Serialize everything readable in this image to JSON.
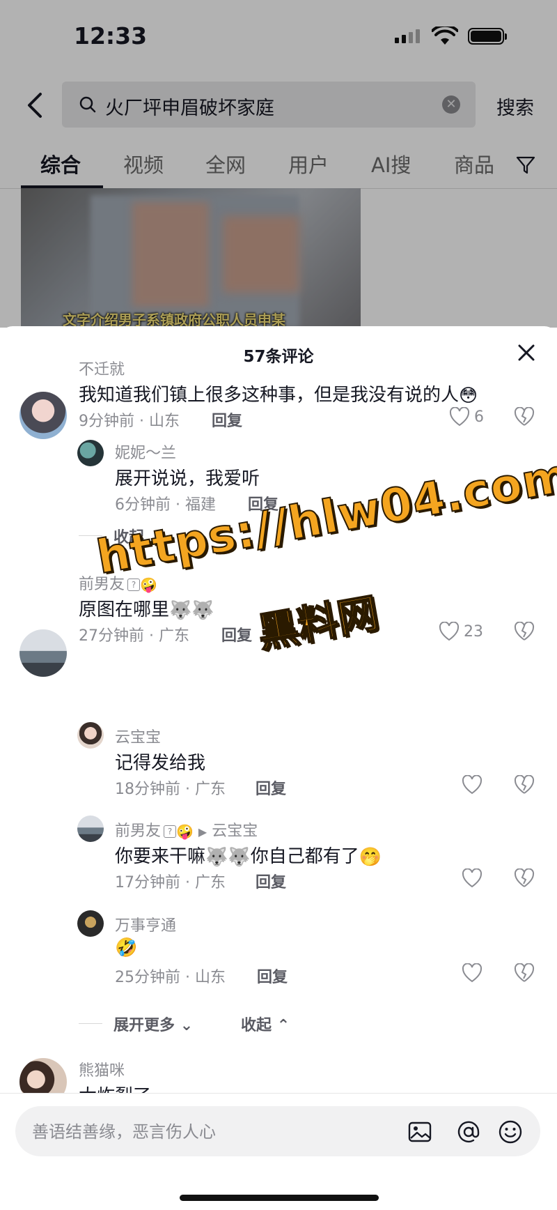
{
  "status_bar": {
    "time": "12:33"
  },
  "search": {
    "query": "火厂坪申眉破坏家庭",
    "button": "搜索"
  },
  "tabs": [
    "综合",
    "视频",
    "全网",
    "用户",
    "AI搜",
    "商品"
  ],
  "video": {
    "caption": "文字介绍男子系镇政府公职人员申某"
  },
  "sheet": {
    "title": "57条评论"
  },
  "comments": [
    {
      "user": "不迁就",
      "text": "我知道我们镇上很多这种事，但是我没有说的人",
      "time_loc": "9分钟前 · 山东",
      "reply": "回复",
      "likes": "6"
    },
    {
      "user": "妮妮～兰",
      "text": "展开说说，我爱听",
      "time_loc": "6分钟前 · 福建",
      "reply": "回复"
    },
    {
      "user": "前男友",
      "text": "原图在哪里",
      "time_loc": "27分钟前 · 广东",
      "reply": "回复",
      "likes": "23"
    },
    {
      "user": "云宝宝",
      "text": "记得发给我",
      "time_loc": "18分钟前 · 广东",
      "reply": "回复"
    },
    {
      "user": "前男友",
      "reply_to": "云宝宝",
      "text_a": "你要来干嘛",
      "text_b": "你自己都有了",
      "time_loc": "17分钟前 · 广东",
      "reply": "回复"
    },
    {
      "user": "万事亨通",
      "time_loc": "25分钟前 · 山东",
      "reply": "回复"
    },
    {
      "user": "熊猫咪",
      "text": "太炸裂了"
    }
  ],
  "thread_controls": {
    "collapse": "收起",
    "expand_more": "展开更多",
    "collapse2": "收起"
  },
  "watermark": {
    "url": "https://hlw04.com",
    "name": "黑料网"
  },
  "input": {
    "placeholder": "善语结善缘，恶言伤人心"
  }
}
